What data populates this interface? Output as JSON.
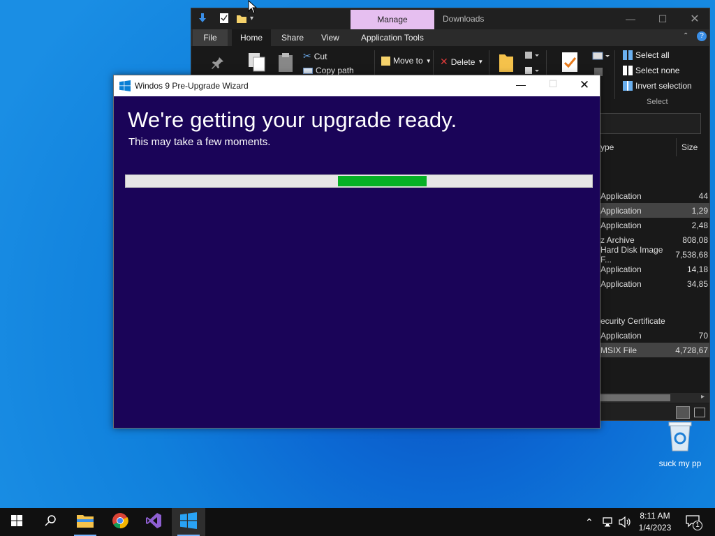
{
  "explorer": {
    "manage_tab": "Manage",
    "window_title": "Downloads",
    "menu": {
      "file": "File",
      "home": "Home",
      "share": "Share",
      "view": "View",
      "app_tools": "Application Tools"
    },
    "ribbon": {
      "cut": "Cut",
      "copy_path": "Copy path",
      "move_to": "Move to",
      "delete": "Delete",
      "select_all": "Select all",
      "select_none": "Select none",
      "invert_selection": "Invert selection",
      "select_group": "Select"
    },
    "columns": {
      "type": "ype",
      "size": "Size"
    },
    "rows": [
      {
        "type": "Application",
        "size": "44"
      },
      {
        "type": "Application",
        "size": "1,29"
      },
      {
        "type": "Application",
        "size": "2,48"
      },
      {
        "type": "z Archive",
        "size": "808,08"
      },
      {
        "type": "Hard Disk Image F...",
        "size": "7,538,68"
      },
      {
        "type": "Application",
        "size": "14,18"
      },
      {
        "type": "Application",
        "size": "34,85"
      },
      {
        "type": "",
        "size": ""
      },
      {
        "type": "ecurity Certificate",
        "size": ""
      },
      {
        "type": "Application",
        "size": "70"
      },
      {
        "type": "MSIX File",
        "size": "4,728,67"
      }
    ]
  },
  "wizard": {
    "title": "Windos 9 Pre-Upgrade Wizard",
    "heading": "We're getting your upgrade ready.",
    "subtitle": "This may take a few moments.",
    "progress": {
      "segment_start": 0.455,
      "segment_end": 0.645
    }
  },
  "desktop": {
    "recycle_bin_label": "suck my pp"
  },
  "taskbar": {
    "items": [
      "start-icon",
      "search-icon",
      "file-explorer-icon",
      "chrome-icon",
      "visual-studio-icon",
      "windows-wizard-icon"
    ],
    "time": "8:11 AM",
    "date": "1/4/2023",
    "notification_count": "1"
  },
  "colors": {
    "wizard_bg": "#1a0458",
    "progress_fill": "#06b025",
    "manage_tab": "#e6bff0"
  }
}
